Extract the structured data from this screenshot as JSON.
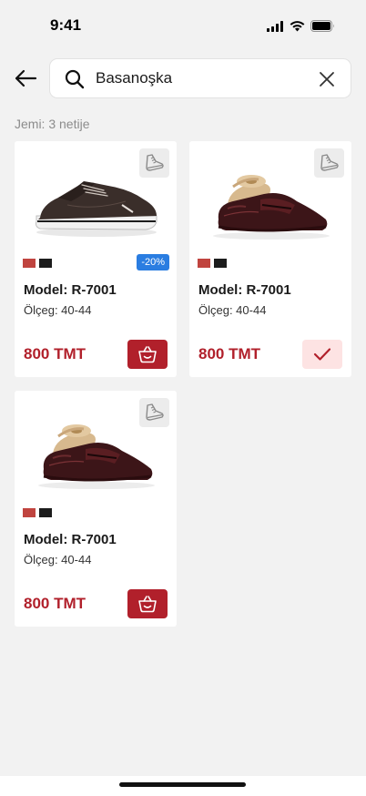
{
  "status": {
    "time": "9:41"
  },
  "search": {
    "value": "Basanoşka",
    "placeholder": ""
  },
  "results": {
    "label": "Jemi: 3 netije"
  },
  "colors": {
    "accent": "#b1202b",
    "discount": "#2a7de1",
    "swatch_red": "#c0443f",
    "swatch_black": "#1c1c1c"
  },
  "products": [
    {
      "model": "Model: R-7001",
      "size": "Ölçeg: 40-44",
      "price": "800 TMT",
      "discount": "-20%",
      "in_cart": false,
      "swatches": [
        "#c0443f",
        "#1c1c1c"
      ],
      "image": "dark-brown-sneaker"
    },
    {
      "model": "Model: R-7001",
      "size": "Ölçeg: 40-44",
      "price": "800 TMT",
      "in_cart": true,
      "swatches": [
        "#c0443f",
        "#1c1c1c"
      ],
      "image": "burgundy-penny-loafer"
    },
    {
      "model": "Model: R-7001",
      "size": "Ölçeg: 40-44",
      "price": "800 TMT",
      "in_cart": false,
      "swatches": [
        "#c0443f",
        "#1c1c1c"
      ],
      "image": "burgundy-penny-loafer"
    }
  ]
}
